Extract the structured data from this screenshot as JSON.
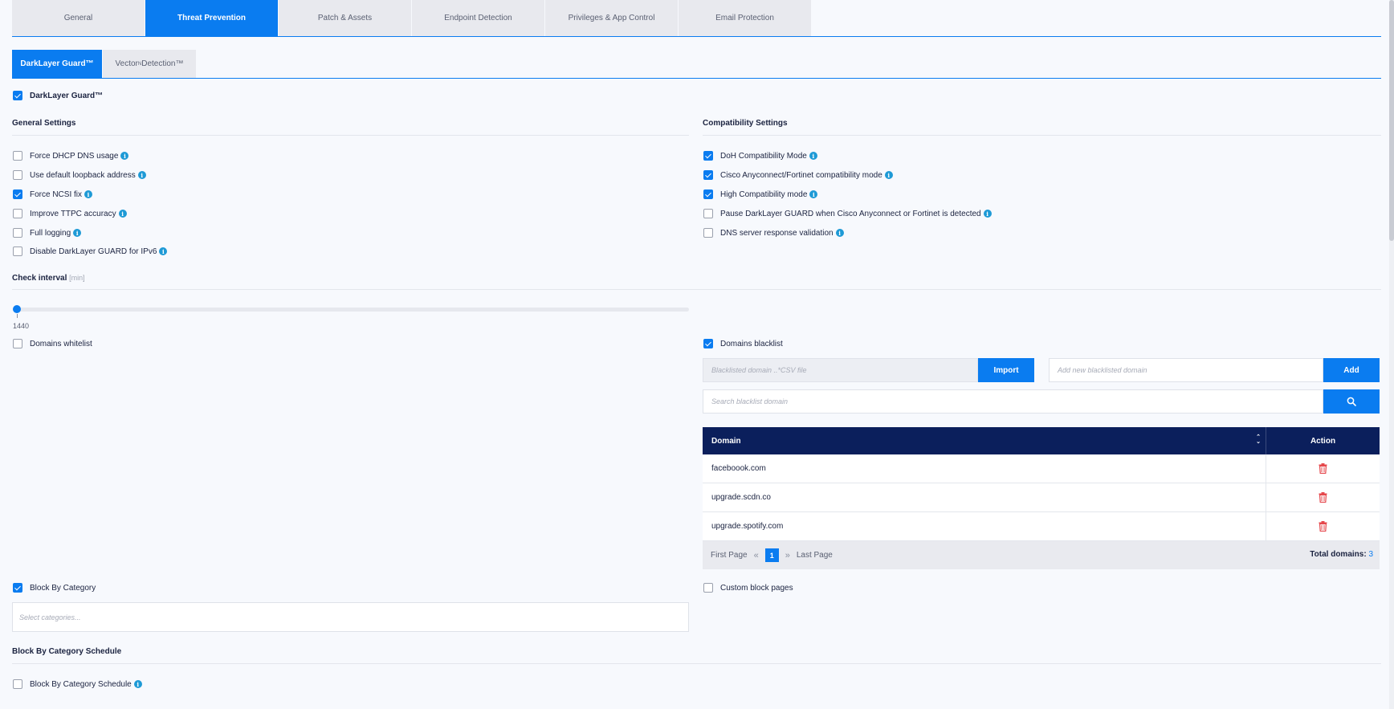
{
  "top_tabs": [
    "General",
    "Threat Prevention",
    "Patch & Assets",
    "Endpoint Detection",
    "Privileges & App Control",
    "Email Protection"
  ],
  "sub_tabs": {
    "darklayer": "DarkLayer Guard™",
    "vector_prefix": "Vector",
    "vector_sup": "N",
    "vector_suffix": " Detection™"
  },
  "main_toggle": {
    "label": "DarkLayer Guard™",
    "checked": true
  },
  "general_settings": {
    "title": "General Settings",
    "items": [
      {
        "label": "Force DHCP DNS usage",
        "checked": false
      },
      {
        "label": "Use default loopback address",
        "checked": false
      },
      {
        "label": "Force NCSI fix",
        "checked": true
      },
      {
        "label": "Improve TTPC accuracy",
        "checked": false
      },
      {
        "label": "Full logging",
        "checked": false
      },
      {
        "label": "Disable DarkLayer GUARD for IPv6",
        "checked": false
      }
    ]
  },
  "compatibility_settings": {
    "title": "Compatibility Settings",
    "items": [
      {
        "label": "DoH Compatibility Mode",
        "checked": true
      },
      {
        "label": "Cisco Anyconnect/Fortinet compatibility mode",
        "checked": true
      },
      {
        "label": "High Compatibility mode",
        "checked": true
      },
      {
        "label": "Pause DarkLayer GUARD when Cisco Anyconnect or Fortinet is detected",
        "checked": false
      },
      {
        "label": "DNS server response validation",
        "checked": false
      }
    ]
  },
  "check_interval": {
    "title": "Check interval",
    "unit": "[min]",
    "value": "1440"
  },
  "whitelist": {
    "label": "Domains whitelist",
    "checked": false
  },
  "blacklist": {
    "label": "Domains blacklist",
    "checked": true,
    "file_placeholder": "Blacklisted domain ..*CSV file",
    "import_label": "Import",
    "add_placeholder": "Add new blacklisted domain",
    "add_label": "Add",
    "search_placeholder": "Search blacklist domain",
    "table": {
      "col_domain": "Domain",
      "col_action": "Action",
      "rows": [
        "faceboook.com",
        "upgrade.scdn.co",
        "upgrade.spotify.com"
      ]
    },
    "pagination": {
      "first": "First Page",
      "last": "Last Page",
      "current": "1",
      "total_label": "Total domains:",
      "total_value": "3"
    }
  },
  "block_by_category": {
    "label": "Block By Category",
    "checked": true,
    "placeholder": "Select categories..."
  },
  "custom_block_pages": {
    "label": "Custom block pages",
    "checked": false
  },
  "schedule": {
    "title": "Block By Category Schedule",
    "toggle_label": "Block By Category Schedule",
    "checked": false
  },
  "colors": {
    "accent": "#0a7cf0",
    "navy": "#0b1f5c",
    "info": "#1e9ad6",
    "danger": "#e5484d"
  }
}
